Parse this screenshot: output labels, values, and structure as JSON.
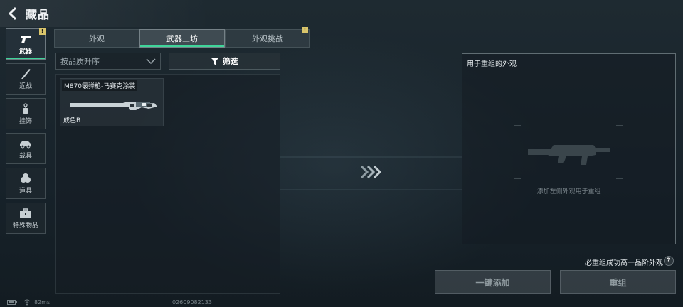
{
  "header": {
    "title": "藏品"
  },
  "sidebar": {
    "items": [
      {
        "label": "武器",
        "icon": "pistol-icon",
        "active": true,
        "badge": "!"
      },
      {
        "label": "近战",
        "icon": "knife-icon",
        "active": false
      },
      {
        "label": "挂饰",
        "icon": "charm-icon",
        "active": false
      },
      {
        "label": "载具",
        "icon": "vehicle-icon",
        "active": false
      },
      {
        "label": "道具",
        "icon": "grenade-icon",
        "active": false
      },
      {
        "label": "特殊物品",
        "icon": "briefcase-icon",
        "active": false
      }
    ]
  },
  "tabs": [
    {
      "label": "外观",
      "active": false
    },
    {
      "label": "武器工坊",
      "active": true
    },
    {
      "label": "外观挑战",
      "active": false,
      "badge": "!"
    }
  ],
  "sort": {
    "value": "按品质升序"
  },
  "filter": {
    "label": "筛选"
  },
  "items": [
    {
      "name": "M870霰弹枪-马赛克涂装",
      "grade": "成色B"
    }
  ],
  "target_panel": {
    "title": "用于重组的外观",
    "hint": "添加左侧外观用于重组"
  },
  "guarantee_text": "必重组成功高一品阶外观",
  "help": "?",
  "buttons": {
    "add": "一键添加",
    "reassemble": "重组"
  },
  "status": {
    "ping": "82ms",
    "uid": "02609082133"
  },
  "colors": {
    "accent": "#3fd59a",
    "badge": "#d9c56b"
  }
}
